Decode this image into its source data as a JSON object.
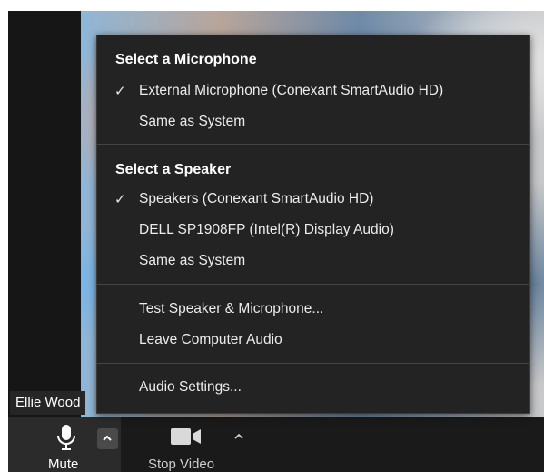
{
  "participant": {
    "name": "Ellie Wood"
  },
  "toolbar": {
    "mute_label": "Mute",
    "stop_video_label": "Stop Video"
  },
  "audio_menu": {
    "microphone_heading": "Select a Microphone",
    "microphones": [
      {
        "label": "External Microphone (Conexant SmartAudio HD)",
        "selected": true
      },
      {
        "label": "Same as System",
        "selected": false
      }
    ],
    "speaker_heading": "Select a Speaker",
    "speakers": [
      {
        "label": "Speakers (Conexant SmartAudio HD)",
        "selected": true
      },
      {
        "label": "DELL SP1908FP (Intel(R) Display Audio)",
        "selected": false
      },
      {
        "label": "Same as System",
        "selected": false
      }
    ],
    "actions": [
      {
        "label": "Test Speaker & Microphone..."
      },
      {
        "label": "Leave Computer Audio"
      }
    ],
    "settings": {
      "label": "Audio Settings..."
    },
    "check_glyph": "✓"
  },
  "icons": {
    "microphone": "microphone-icon",
    "camera": "camera-icon",
    "caret": "chevron-up-icon",
    "check": "checkmark-icon"
  },
  "colors": {
    "menu_bg": "#232323",
    "toolbar_bg": "#1a1a1a",
    "text": "#ffffff"
  }
}
